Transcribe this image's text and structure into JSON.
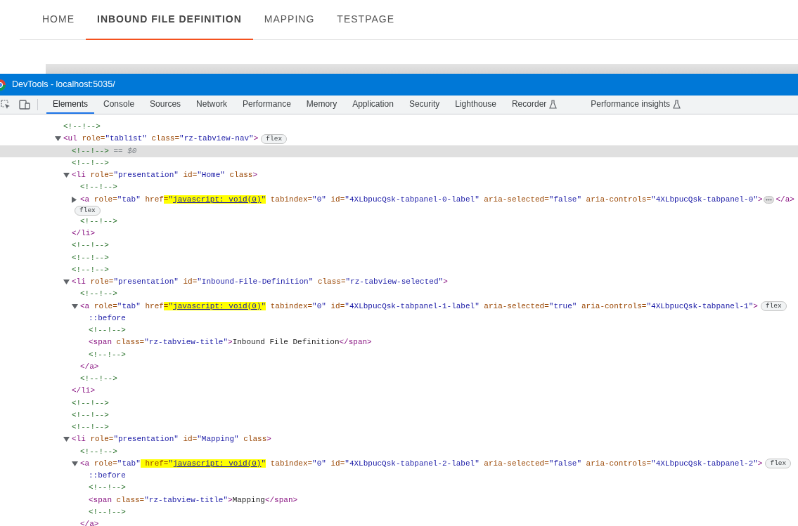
{
  "page": {
    "tabs": [
      {
        "label": "HOME",
        "selected": false
      },
      {
        "label": "INBOUND FILE DEFINITION",
        "selected": true
      },
      {
        "label": "MAPPING",
        "selected": false
      },
      {
        "label": "TESTPAGE",
        "selected": false
      }
    ]
  },
  "devtools": {
    "title": "DevTools - localhost:5035/",
    "tabs": [
      {
        "label": "Elements",
        "selected": true,
        "experimental": false
      },
      {
        "label": "Console",
        "selected": false,
        "experimental": false
      },
      {
        "label": "Sources",
        "selected": false,
        "experimental": false
      },
      {
        "label": "Network",
        "selected": false,
        "experimental": false
      },
      {
        "label": "Performance",
        "selected": false,
        "experimental": false
      },
      {
        "label": "Memory",
        "selected": false,
        "experimental": false
      },
      {
        "label": "Application",
        "selected": false,
        "experimental": false
      },
      {
        "label": "Security",
        "selected": false,
        "experimental": false
      },
      {
        "label": "Lighthouse",
        "selected": false,
        "experimental": false
      },
      {
        "label": "Recorder",
        "selected": false,
        "experimental": true
      },
      {
        "label": "Performance insights",
        "selected": false,
        "experimental": true
      }
    ]
  },
  "tree": [
    {
      "selected": false,
      "tokens": [
        {
          "kind": "comment",
          "text": "<!--!-->"
        }
      ]
    },
    {
      "selected": false,
      "expanded": true,
      "tokens": [
        {
          "kind": "tag",
          "text": "<ul"
        },
        {
          "kind": "attr",
          "text": " role="
        },
        {
          "kind": "value",
          "text": "\"tablist\""
        },
        {
          "kind": "attr",
          "text": " class="
        },
        {
          "kind": "value",
          "text": "\"rz-tabview-nav\""
        },
        {
          "kind": "tag",
          "text": ">"
        },
        {
          "kind": "badge",
          "text": "flex"
        }
      ],
      "children": [
        {
          "selected": true,
          "tokens": [
            {
              "kind": "comment",
              "text": "<!--!-->"
            },
            {
              "kind": "hint",
              "text": " == "
            },
            {
              "kind": "var",
              "text": "$0"
            }
          ]
        },
        {
          "selected": false,
          "tokens": [
            {
              "kind": "comment",
              "text": "<!--!-->"
            }
          ]
        },
        {
          "selected": false,
          "expanded": true,
          "tokens": [
            {
              "kind": "tag",
              "text": "<li"
            },
            {
              "kind": "attr",
              "text": " role="
            },
            {
              "kind": "value",
              "text": "\"presentation\""
            },
            {
              "kind": "attr",
              "text": " id="
            },
            {
              "kind": "value",
              "text": "\"Home\""
            },
            {
              "kind": "attr",
              "text": " class"
            },
            {
              "kind": "tag",
              "text": ">"
            }
          ],
          "children": [
            {
              "selected": false,
              "tokens": [
                {
                  "kind": "comment",
                  "text": "<!--!-->"
                }
              ]
            },
            {
              "selected": false,
              "expanded": false,
              "tokens": [
                {
                  "kind": "tag",
                  "text": "<a"
                },
                {
                  "kind": "attr",
                  "text": " role="
                },
                {
                  "kind": "value",
                  "text": "\"tab\""
                },
                {
                  "kind": "attr",
                  "text": " href"
                },
                {
                  "kind": "mark",
                  "tokens": [
                    {
                      "kind": "attr",
                      "text": "="
                    },
                    {
                      "kind": "value",
                      "text": "\""
                    },
                    {
                      "kind": "link",
                      "text": "javascript: void(0)"
                    },
                    {
                      "kind": "value",
                      "text": "\""
                    }
                  ]
                },
                {
                  "kind": "attr",
                  "text": " tabindex="
                },
                {
                  "kind": "value",
                  "text": "\"0\""
                },
                {
                  "kind": "attr",
                  "text": " id="
                },
                {
                  "kind": "value",
                  "text": "\"4XLbpucQsk-tabpanel-0-label\""
                },
                {
                  "kind": "attr",
                  "text": " aria-selected="
                },
                {
                  "kind": "value",
                  "text": "\"false\""
                },
                {
                  "kind": "attr",
                  "text": " aria-controls="
                },
                {
                  "kind": "value",
                  "text": "\"4XLbpucQsk-tabpanel-0\""
                },
                {
                  "kind": "tag",
                  "text": ">"
                },
                {
                  "kind": "more"
                },
                {
                  "kind": "tag",
                  "text": "</a>"
                },
                {
                  "kind": "badge",
                  "text": "flex"
                }
              ]
            },
            {
              "selected": false,
              "tokens": [
                {
                  "kind": "comment",
                  "text": "<!--!-->"
                }
              ]
            }
          ],
          "close": [
            {
              "kind": "tag",
              "text": "</li>"
            }
          ]
        },
        {
          "selected": false,
          "tokens": [
            {
              "kind": "comment",
              "text": "<!--!-->"
            }
          ]
        },
        {
          "selected": false,
          "tokens": [
            {
              "kind": "comment",
              "text": "<!--!-->"
            }
          ]
        },
        {
          "selected": false,
          "tokens": [
            {
              "kind": "comment",
              "text": "<!--!-->"
            }
          ]
        },
        {
          "selected": false,
          "expanded": true,
          "tokens": [
            {
              "kind": "tag",
              "text": "<li"
            },
            {
              "kind": "attr",
              "text": " role="
            },
            {
              "kind": "value",
              "text": "\"presentation\""
            },
            {
              "kind": "attr",
              "text": " id="
            },
            {
              "kind": "value",
              "text": "\"Inbound-File-Definition\""
            },
            {
              "kind": "attr",
              "text": " class="
            },
            {
              "kind": "value",
              "text": "\"rz-tabview-selected\""
            },
            {
              "kind": "tag",
              "text": ">"
            }
          ],
          "children": [
            {
              "selected": false,
              "tokens": [
                {
                  "kind": "comment",
                  "text": "<!--!-->"
                }
              ]
            },
            {
              "selected": false,
              "expanded": true,
              "tokens": [
                {
                  "kind": "tag",
                  "text": "<a"
                },
                {
                  "kind": "attr",
                  "text": " role="
                },
                {
                  "kind": "value",
                  "text": "\"tab\""
                },
                {
                  "kind": "attr",
                  "text": " href"
                },
                {
                  "kind": "mark",
                  "tokens": [
                    {
                      "kind": "attr",
                      "text": "="
                    },
                    {
                      "kind": "value",
                      "text": "\""
                    },
                    {
                      "kind": "link",
                      "text": "javascript: void(0)"
                    },
                    {
                      "kind": "value",
                      "text": "\""
                    }
                  ]
                },
                {
                  "kind": "attr",
                  "text": " tabindex="
                },
                {
                  "kind": "value",
                  "text": "\"0\""
                },
                {
                  "kind": "attr",
                  "text": " id="
                },
                {
                  "kind": "value",
                  "text": "\"4XLbpucQsk-tabpanel-1-label\""
                },
                {
                  "kind": "attr",
                  "text": " aria-selected="
                },
                {
                  "kind": "value",
                  "text": "\"true\""
                },
                {
                  "kind": "attr",
                  "text": " aria-controls="
                },
                {
                  "kind": "value",
                  "text": "\"4XLbpucQsk-tabpanel-1\""
                },
                {
                  "kind": "tag",
                  "text": ">"
                },
                {
                  "kind": "badge",
                  "text": "flex"
                }
              ],
              "children": [
                {
                  "selected": false,
                  "tokens": [
                    {
                      "kind": "pseudo",
                      "text": "::before"
                    }
                  ]
                },
                {
                  "selected": false,
                  "tokens": [
                    {
                      "kind": "comment",
                      "text": "<!--!-->"
                    }
                  ]
                },
                {
                  "selected": false,
                  "tokens": [
                    {
                      "kind": "tag",
                      "text": "<span"
                    },
                    {
                      "kind": "attr",
                      "text": " class="
                    },
                    {
                      "kind": "value",
                      "text": "\"rz-tabview-title\""
                    },
                    {
                      "kind": "tag",
                      "text": ">"
                    },
                    {
                      "kind": "text",
                      "text": "Inbound File Definition"
                    },
                    {
                      "kind": "tag",
                      "text": "</span>"
                    }
                  ]
                },
                {
                  "selected": false,
                  "tokens": [
                    {
                      "kind": "comment",
                      "text": "<!--!-->"
                    }
                  ]
                }
              ],
              "close": [
                {
                  "kind": "tag",
                  "text": "</a>"
                }
              ]
            },
            {
              "selected": false,
              "tokens": [
                {
                  "kind": "comment",
                  "text": "<!--!-->"
                }
              ]
            }
          ],
          "close": [
            {
              "kind": "tag",
              "text": "</li>"
            }
          ]
        },
        {
          "selected": false,
          "tokens": [
            {
              "kind": "comment",
              "text": "<!--!-->"
            }
          ]
        },
        {
          "selected": false,
          "tokens": [
            {
              "kind": "comment",
              "text": "<!--!-->"
            }
          ]
        },
        {
          "selected": false,
          "tokens": [
            {
              "kind": "comment",
              "text": "<!--!-->"
            }
          ]
        },
        {
          "selected": false,
          "expanded": true,
          "tokens": [
            {
              "kind": "tag",
              "text": "<li"
            },
            {
              "kind": "attr",
              "text": " role="
            },
            {
              "kind": "value",
              "text": "\"presentation\""
            },
            {
              "kind": "attr",
              "text": " id="
            },
            {
              "kind": "value",
              "text": "\"Mapping\""
            },
            {
              "kind": "attr",
              "text": " class"
            },
            {
              "kind": "tag",
              "text": ">"
            }
          ],
          "children": [
            {
              "selected": false,
              "tokens": [
                {
                  "kind": "comment",
                  "text": "<!--!-->"
                }
              ]
            },
            {
              "selected": false,
              "expanded": true,
              "tokens": [
                {
                  "kind": "tag",
                  "text": "<a"
                },
                {
                  "kind": "attr",
                  "text": " role="
                },
                {
                  "kind": "value",
                  "text": "\"tab\""
                },
                {
                  "kind": "mark",
                  "tokens": [
                    {
                      "kind": "attr",
                      "text": " href="
                    },
                    {
                      "kind": "value",
                      "text": "\""
                    },
                    {
                      "kind": "link",
                      "text": "javascript: void(0)"
                    },
                    {
                      "kind": "value",
                      "text": "\""
                    }
                  ]
                },
                {
                  "kind": "attr",
                  "text": " tabindex="
                },
                {
                  "kind": "value",
                  "text": "\"0\""
                },
                {
                  "kind": "attr",
                  "text": " id="
                },
                {
                  "kind": "value",
                  "text": "\"4XLbpucQsk-tabpanel-2-label\""
                },
                {
                  "kind": "attr",
                  "text": " aria-selected="
                },
                {
                  "kind": "value",
                  "text": "\"false\""
                },
                {
                  "kind": "attr",
                  "text": " aria-controls="
                },
                {
                  "kind": "value",
                  "text": "\"4XLbpucQsk-tabpanel-2\""
                },
                {
                  "kind": "tag",
                  "text": ">"
                },
                {
                  "kind": "badge",
                  "text": "flex"
                }
              ],
              "children": [
                {
                  "selected": false,
                  "tokens": [
                    {
                      "kind": "pseudo",
                      "text": "::before"
                    }
                  ]
                },
                {
                  "selected": false,
                  "tokens": [
                    {
                      "kind": "comment",
                      "text": "<!--!-->"
                    }
                  ]
                },
                {
                  "selected": false,
                  "tokens": [
                    {
                      "kind": "tag",
                      "text": "<span"
                    },
                    {
                      "kind": "attr",
                      "text": " class="
                    },
                    {
                      "kind": "value",
                      "text": "\"rz-tabview-title\""
                    },
                    {
                      "kind": "tag",
                      "text": ">"
                    },
                    {
                      "kind": "text",
                      "text": "Mapping"
                    },
                    {
                      "kind": "tag",
                      "text": "</span>"
                    }
                  ]
                },
                {
                  "selected": false,
                  "tokens": [
                    {
                      "kind": "comment",
                      "text": "<!--!-->"
                    }
                  ]
                }
              ],
              "close": [
                {
                  "kind": "tag",
                  "text": "</a>"
                }
              ]
            }
          ]
        }
      ]
    }
  ]
}
